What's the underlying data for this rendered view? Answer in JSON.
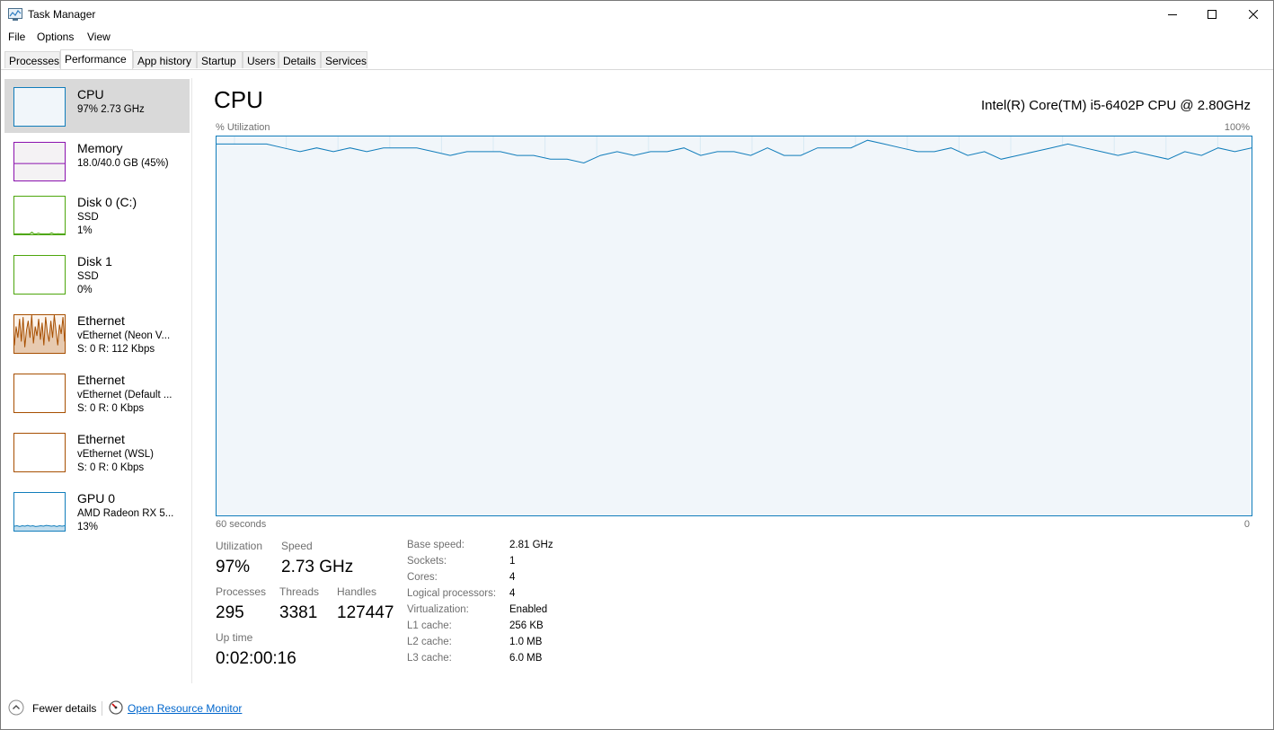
{
  "window": {
    "title": "Task Manager",
    "minimize": "—",
    "maximize": "☐",
    "close": "✕"
  },
  "menu": [
    "File",
    "Options",
    "View"
  ],
  "tabs": [
    {
      "label": "Processes",
      "active": false
    },
    {
      "label": "Performance",
      "active": true
    },
    {
      "label": "App history",
      "active": false
    },
    {
      "label": "Startup",
      "active": false
    },
    {
      "label": "Users",
      "active": false
    },
    {
      "label": "Details",
      "active": false
    },
    {
      "label": "Services",
      "active": false
    }
  ],
  "sidebar": {
    "items": [
      {
        "name": "CPU",
        "lines": [
          "97%  2.73 GHz"
        ],
        "color": "#117dbb",
        "fill": "#f1f6fa",
        "selected": true,
        "spark": []
      },
      {
        "name": "Memory",
        "lines": [
          "18.0/40.0 GB (45%)"
        ],
        "color": "#8b12ae",
        "fill": "#f4f2f4",
        "selected": false,
        "spark": []
      },
      {
        "name": "Disk 0 (C:)",
        "lines": [
          "SSD",
          "1%"
        ],
        "color": "#4da60c",
        "fill": "#ffffff",
        "selected": false,
        "spark": [
          0,
          0,
          0,
          2,
          0,
          0,
          1,
          0,
          6,
          0,
          0,
          3,
          0,
          0,
          1,
          0,
          0,
          4,
          0,
          0,
          2,
          0,
          0,
          1
        ]
      },
      {
        "name": "Disk 1",
        "lines": [
          "SSD",
          "0%"
        ],
        "color": "#4da60c",
        "fill": "#ffffff",
        "selected": false,
        "spark": []
      },
      {
        "name": "Ethernet",
        "lines": [
          "vEthernet (Neon V...",
          "S: 0  R: 112 Kbps"
        ],
        "color": "#a74f01",
        "fill": "#fcf3eb",
        "selected": false,
        "spark": [
          20,
          70,
          40,
          90,
          30,
          95,
          15,
          60,
          85,
          40,
          100,
          25,
          70,
          45,
          90,
          35,
          80,
          20,
          95,
          55,
          30,
          85,
          40,
          100,
          60,
          20,
          75,
          50,
          95,
          30
        ]
      },
      {
        "name": "Ethernet",
        "lines": [
          "vEthernet (Default ...",
          "S: 0  R: 0 Kbps"
        ],
        "color": "#a74f01",
        "fill": "#ffffff",
        "selected": false,
        "spark": []
      },
      {
        "name": "Ethernet",
        "lines": [
          "vEthernet (WSL)",
          "S: 0  R: 0 Kbps"
        ],
        "color": "#a74f01",
        "fill": "#ffffff",
        "selected": false,
        "spark": []
      },
      {
        "name": "GPU 0",
        "lines": [
          "AMD Radeon RX 5...",
          "13%"
        ],
        "color": "#117dbb",
        "fill": "#ffffff",
        "selected": false,
        "spark": [
          12,
          13,
          11,
          13,
          12,
          14,
          12,
          13,
          11,
          12,
          13,
          12,
          14,
          13,
          12,
          13,
          11,
          13,
          12,
          13
        ]
      }
    ]
  },
  "main": {
    "title": "CPU",
    "model": "Intel(R) Core(TM) i5-6402P CPU @ 2.80GHz",
    "graph_label": "% Utilization",
    "graph_max": "100%",
    "time_left": "60 seconds",
    "time_right": "0",
    "utilization_series": [
      98,
      98,
      98,
      98,
      97,
      96,
      97,
      96,
      97,
      96,
      97,
      97,
      97,
      96,
      95,
      96,
      96,
      96,
      95,
      95,
      94,
      94,
      93,
      95,
      96,
      95,
      96,
      96,
      97,
      95,
      96,
      96,
      95,
      97,
      95,
      95,
      97,
      97,
      97,
      99,
      98,
      97,
      96,
      96,
      97,
      95,
      96,
      94,
      95,
      96,
      97,
      98,
      97,
      96,
      95,
      96,
      95,
      94,
      96,
      95,
      97,
      96,
      97
    ]
  },
  "stats": {
    "utilization": {
      "label": "Utilization",
      "value": "97%"
    },
    "speed": {
      "label": "Speed",
      "value": "2.73 GHz"
    },
    "processes": {
      "label": "Processes",
      "value": "295"
    },
    "threads": {
      "label": "Threads",
      "value": "3381"
    },
    "handles": {
      "label": "Handles",
      "value": "127447"
    },
    "uptime": {
      "label": "Up time",
      "value": "0:02:00:16"
    }
  },
  "specs": [
    {
      "label": "Base speed:",
      "value": "2.81 GHz"
    },
    {
      "label": "Sockets:",
      "value": "1"
    },
    {
      "label": "Cores:",
      "value": "4"
    },
    {
      "label": "Logical processors:",
      "value": "4"
    },
    {
      "label": "Virtualization:",
      "value": "Enabled"
    },
    {
      "label": "L1 cache:",
      "value": "256 KB"
    },
    {
      "label": "L2 cache:",
      "value": "1.0 MB"
    },
    {
      "label": "L3 cache:",
      "value": "6.0 MB"
    }
  ],
  "footer": {
    "fewer_details": "Fewer details",
    "open_resource_monitor": "Open Resource Monitor"
  }
}
